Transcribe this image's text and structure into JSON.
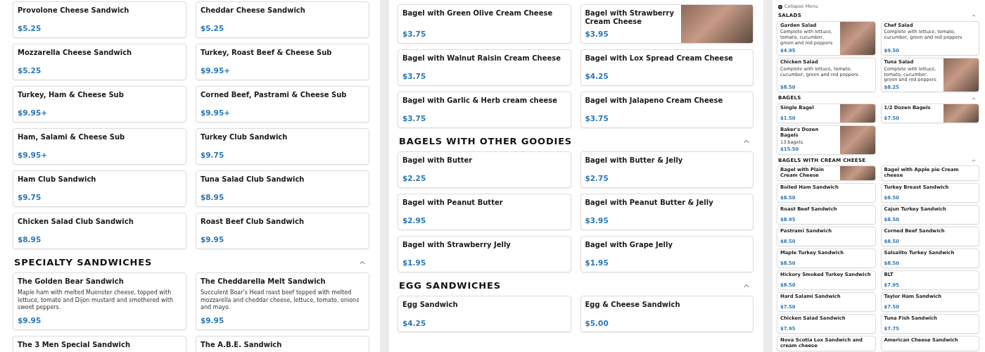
{
  "panels": [
    {
      "sections": [
        {
          "items": [
            {
              "name": "Provolone Cheese Sandwich",
              "price": "$5.25"
            },
            {
              "name": "Cheddar Cheese Sandwich",
              "price": "$5.25"
            },
            {
              "name": "Mozzarella Cheese Sandwich",
              "price": "$5.25"
            },
            {
              "name": "Turkey, Roast Beef & Cheese Sub",
              "price": "$9.95+"
            },
            {
              "name": "Turkey, Ham & Cheese Sub",
              "price": "$9.95+"
            },
            {
              "name": "Corned Beef, Pastrami & Cheese Sub",
              "price": "$9.95+"
            },
            {
              "name": "Ham, Salami & Cheese Sub",
              "price": "$9.95+"
            },
            {
              "name": "Turkey Club Sandwich",
              "price": "$9.75"
            },
            {
              "name": "Ham Club Sandwich",
              "price": "$9.75"
            },
            {
              "name": "Tuna Salad Club Sandwich",
              "price": "$8.95"
            },
            {
              "name": "Chicken Salad Club Sandwich",
              "price": "$8.95"
            },
            {
              "name": "Roast Beef Club Sandwich",
              "price": "$9.95"
            }
          ]
        },
        {
          "title": "SPECIALTY SANDWICHES",
          "items": [
            {
              "name": "The Golden Bear Sandwich",
              "description": "Maple ham with melted Muenster cheese, topped with lettuce, tomato and Dijon mustard and smothered with sweet peppers.",
              "price": "$9.95"
            },
            {
              "name": "The Cheddarella Melt Sandwich",
              "description": "Succulent Boar's Head roast beef topped with melted mozzarella and cheddar cheese, lettuce, tomato, onions and mayo.",
              "price": "$9.95"
            },
            {
              "name": "The 3 Men Special Sandwich"
            },
            {
              "name": "The A.B.E. Sandwich"
            }
          ]
        }
      ]
    },
    {
      "sections": [
        {
          "items": [
            {
              "name": "Bagel with Green Olive Cream Cheese",
              "price": "$3.75"
            },
            {
              "name": "Bagel with Strawberry Cream Cheese",
              "price": "$3.95",
              "photo": true
            },
            {
              "name": "Bagel with Walnut Raisin Cream Cheese",
              "price": "$3.75"
            },
            {
              "name": "Bagel with Lox Spread Cream Cheese",
              "price": "$4.25"
            },
            {
              "name": "Bagel with Garlic & Herb cream cheese",
              "price": "$3.75"
            },
            {
              "name": "Bagel with Jalapeno Cream Cheese",
              "price": "$3.75"
            }
          ]
        },
        {
          "title": "BAGELS WITH OTHER GOODIES",
          "items": [
            {
              "name": "Bagel with Butter",
              "price": "$2.25"
            },
            {
              "name": "Bagel with Butter & Jelly",
              "price": "$2.75"
            },
            {
              "name": "Bagel with Peanut Butter",
              "price": "$2.95"
            },
            {
              "name": "Bagel with Peanut Butter & Jelly",
              "price": "$3.95"
            },
            {
              "name": "Bagel with Strawberry Jelly",
              "price": "$1.95"
            },
            {
              "name": "Bagel with Grape Jelly",
              "price": "$1.95"
            }
          ]
        },
        {
          "title": "EGG SANDWICHES",
          "items": [
            {
              "name": "Egg Sandwich",
              "price": "$4.25"
            },
            {
              "name": "Egg & Cheese Sandwich",
              "price": "$5.00"
            }
          ]
        }
      ]
    },
    {
      "collapse_menu": "Collapse Menu",
      "sections": [
        {
          "title": "SALADS",
          "items": [
            {
              "name": "Garden Salad",
              "description": "Complete with lettuce, tomato, cucumber, green and red peppers",
              "price": "$4.95",
              "photo": true
            },
            {
              "name": "Chef Salad",
              "description": "Complete with lettuce, tomato, cucumber, green and red peppers",
              "price": "$9.50"
            },
            {
              "name": "Chicken Salad",
              "description": "Complete with lettuce, tomato, cucumber, green and red peppers",
              "price": "$8.50"
            },
            {
              "name": "Tuna Salad",
              "description": "Complete with lettuce, tomato, cucumber, green and red peppers",
              "price": "$8.25",
              "photo": true
            }
          ]
        },
        {
          "title": "BAGELS",
          "items": [
            {
              "name": "Single Bagel",
              "price": "$1.50",
              "photo": true
            },
            {
              "name": "1/2 Dozen Bagels",
              "price": "$7.50",
              "photo": true
            },
            {
              "name": "Baker's Dozen Bagels",
              "description": "13 bagels.",
              "price": "$15.50",
              "photo": true
            }
          ]
        },
        {
          "title": "BAGELS WITH CREAM CHEESE",
          "items": [
            {
              "name": "Bagel with Plain Cream Cheese",
              "photo": true
            },
            {
              "name": "Bagel with Apple pie Cream cheese"
            }
          ]
        },
        {
          "items": [
            {
              "name": "Boiled Ham Sandwich",
              "price": "$8.50"
            },
            {
              "name": "Turkey Breast Sandwich",
              "price": "$8.50"
            },
            {
              "name": "Roast Beef Sandwich",
              "price": "$8.95"
            },
            {
              "name": "Cajun Turkey Sandwich",
              "price": "$8.50"
            },
            {
              "name": "Pastrami Sandwich",
              "price": "$8.50"
            },
            {
              "name": "Corned Beef Sandwich",
              "price": "$8.50"
            },
            {
              "name": "Maple Turkey Sandwich",
              "price": "$8.50"
            },
            {
              "name": "Salsalito Turkey Sandwich",
              "price": "$8.50"
            },
            {
              "name": "Hickory Smoked Turkey Sandwich",
              "price": "$8.50"
            },
            {
              "name": "BLT",
              "price": "$7.95"
            },
            {
              "name": "Hard Salami Sandwich",
              "price": "$7.50"
            },
            {
              "name": "Taylor Ham Sandwich",
              "price": "$7.50"
            },
            {
              "name": "Chicken Salad Sandwich",
              "price": "$7.95"
            },
            {
              "name": "Tuna Fish Sandwich",
              "price": "$7.75"
            },
            {
              "name": "Nova Scotia Lox Sandwich and cream cheese"
            },
            {
              "name": "American Cheese Sandwich"
            }
          ]
        }
      ]
    }
  ]
}
